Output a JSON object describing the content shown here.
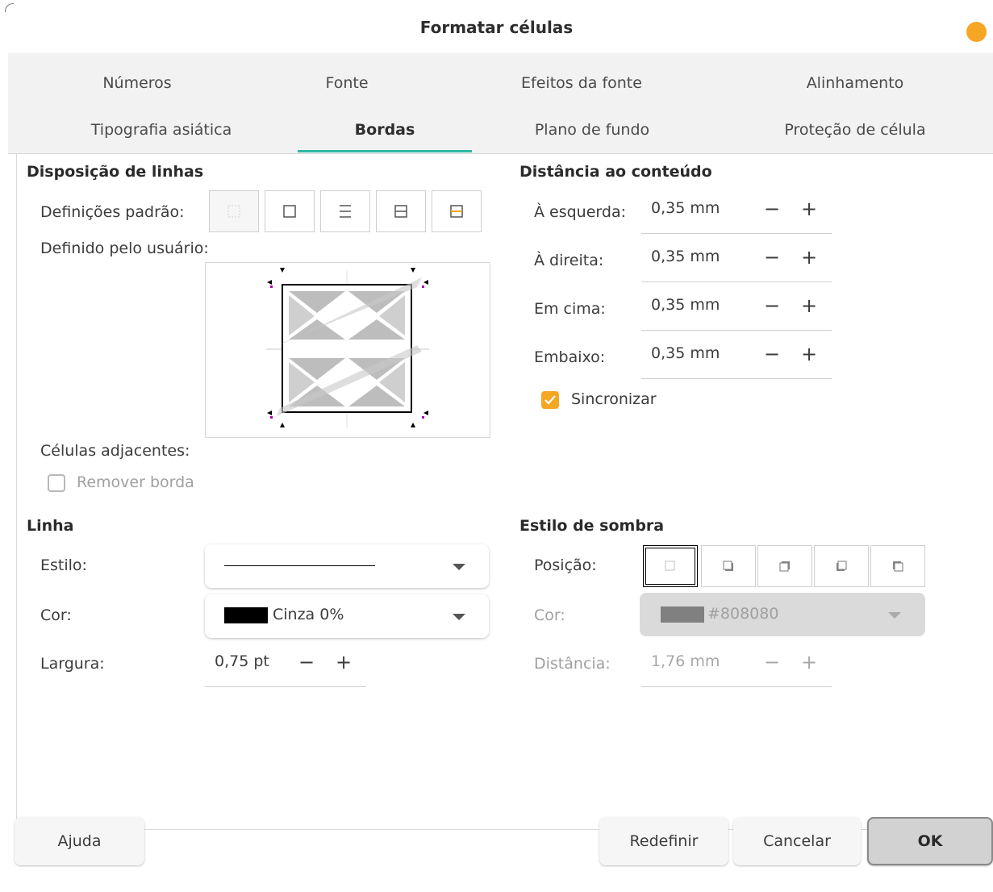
{
  "dialog": {
    "title": "Formatar células"
  },
  "tabs": {
    "row1": [
      "Números",
      "Fonte",
      "Efeitos da fonte",
      "Alinhamento"
    ],
    "row2": [
      "Tipografia asiática",
      "Bordas",
      "Plano de fundo",
      "Proteção de célula"
    ],
    "active": "Bordas"
  },
  "line_arrangement": {
    "title": "Disposição de linhas",
    "presets_label": "Definições padrão:",
    "user_defined_label": "Definido pelo usuário:",
    "presets": [
      "no-borders-icon",
      "outer-border-icon",
      "outer-horizontal-icon",
      "outer-inner-horizontal-icon",
      "outer-highlight-icon"
    ]
  },
  "adjacent_cells": {
    "label": "Células adjacentes:",
    "remove_border_label": "Remover borda",
    "remove_border_checked": false
  },
  "line": {
    "title": "Linha",
    "style_label": "Estilo:",
    "color_label": "Cor:",
    "color_value": "Cinza 0%",
    "color_swatch": "#000000",
    "width_label": "Largura:",
    "width_value": "0,75 pt"
  },
  "padding": {
    "title": "Distância ao conteúdo",
    "left_label": "À esquerda:",
    "left_value": "0,35 mm",
    "right_label": "À direita:",
    "right_value": "0,35 mm",
    "top_label": "Em cima:",
    "top_value": "0,35 mm",
    "bottom_label": "Embaixo:",
    "bottom_value": "0,35 mm",
    "sync_label": "Sincronizar",
    "sync_checked": true
  },
  "shadow": {
    "title": "Estilo de sombra",
    "position_label": "Posição:",
    "color_label": "Cor:",
    "color_value": "#808080",
    "color_swatch": "#808080",
    "distance_label": "Distância:",
    "distance_value": "1,76 mm",
    "positions": [
      "no-shadow-icon",
      "shadow-bottom-right-icon",
      "shadow-top-right-icon",
      "shadow-bottom-left-icon",
      "shadow-top-left-icon"
    ]
  },
  "spin": {
    "minus": "−",
    "plus": "+"
  },
  "buttons": {
    "help": "Ajuda",
    "reset": "Redefinir",
    "cancel": "Cancelar",
    "ok": "OK"
  },
  "colors": {
    "accent": "#f5a623",
    "tab_underline": "#2fb8a4"
  }
}
